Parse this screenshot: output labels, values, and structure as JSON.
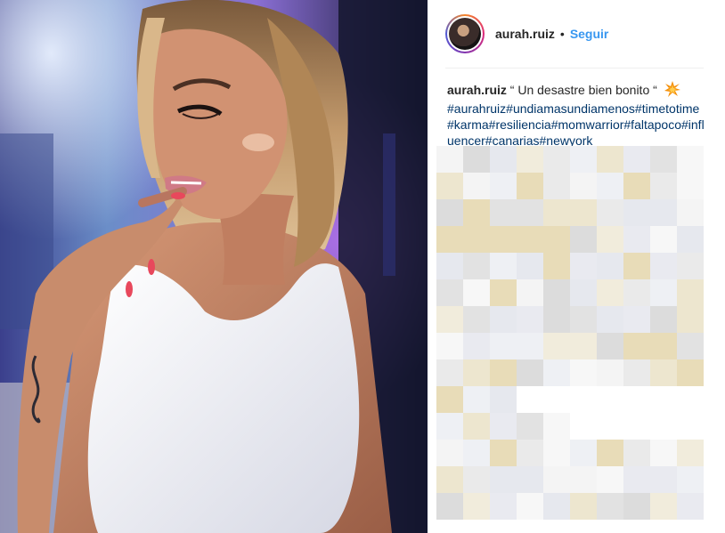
{
  "post": {
    "username": "aurah.ruiz",
    "separator": "•",
    "follow_label": "Seguir",
    "caption_user": "aurah.ruiz",
    "caption_text": "“ Un desastre bien bonito “",
    "caption_emoji": "collision-emoji",
    "hashtags": "#aurahruiz#undiamasundiamenos#timetotime#karma#resiliencia#momwarrior#faltapoco#influencer#canarias#newyork"
  },
  "photo": {
    "subject": "woman-portrait-photo"
  },
  "comments": {
    "state": "pixelated"
  }
}
